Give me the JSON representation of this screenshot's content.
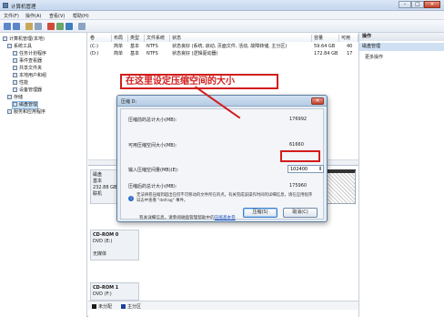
{
  "window": {
    "title": "计算机管理"
  },
  "menu": [
    "文件(F)",
    "操作(A)",
    "查看(V)",
    "帮助(H)"
  ],
  "tree": {
    "root": "计算机管理(本地)",
    "items": [
      {
        "label": "系统工具",
        "level": 1
      },
      {
        "label": "任务计划程序",
        "level": 2
      },
      {
        "label": "事件查看器",
        "level": 2
      },
      {
        "label": "共享文件夹",
        "level": 2
      },
      {
        "label": "本地用户和组",
        "level": 2
      },
      {
        "label": "性能",
        "level": 2
      },
      {
        "label": "设备管理器",
        "level": 2
      },
      {
        "label": "存储",
        "level": 1
      },
      {
        "label": "磁盘管理",
        "level": 2,
        "selected": true
      },
      {
        "label": "服务和应用程序",
        "level": 1
      }
    ]
  },
  "volumes": {
    "headers": [
      "卷",
      "布局",
      "类型",
      "文件系统",
      "状态",
      "容量",
      "可用"
    ],
    "rows": [
      {
        "vol": "(C:)",
        "layout": "简单",
        "type": "基本",
        "fs": "NTFS",
        "status": "状态良好 (系统, 启动, 页面文件, 活动, 故障转储, 主分区)",
        "capacity": "59.64 GB",
        "free": "40"
      },
      {
        "vol": "(D:)",
        "layout": "简单",
        "type": "基本",
        "fs": "NTFS",
        "status": "状态良好 (逻辑驱动器)",
        "capacity": "172.84 GB",
        "free": "17"
      }
    ]
  },
  "disks": [
    {
      "name": "磁盘",
      "type": "基本",
      "size": "232.88 GB",
      "status": "联机"
    },
    {
      "name": "CD-ROM 0",
      "type": "DVD (E:)",
      "size": "",
      "status": "无媒体"
    },
    {
      "name": "CD-ROM 1",
      "type": "DVD (F:)",
      "size": "",
      "status": ""
    }
  ],
  "legend": [
    "未分配",
    "主分区"
  ],
  "actions": {
    "header": "操作",
    "section": "磁盘管理",
    "more": "更多操作"
  },
  "dialog": {
    "title": "压缩 D:",
    "fields": [
      {
        "label": "压缩前的总计大小(MB):",
        "value": "176992"
      },
      {
        "label": "可用压缩空间大小(MB):",
        "value": "61660"
      },
      {
        "label": "输入压缩空间量(MB)(E):",
        "value": "102400"
      },
      {
        "label": "压缩后的总计大小(MB):",
        "value": "175960"
      }
    ],
    "note": "无法将卷压缩到超出任何不可移动的文件所在的点。有关完成该操作时间的详细信息，请在应用程序日志中查看 \"defrag\" 事件。",
    "help_prefix": "有关详细信息，请参阅磁盘管理帮助中的",
    "help_link": "压缩基本卷",
    "btn_shrink": "压缩(S)",
    "btn_cancel": "取消(C)"
  },
  "annotation": {
    "text": "在这里设定压缩空间的大小",
    "color": "#d21d1d"
  }
}
